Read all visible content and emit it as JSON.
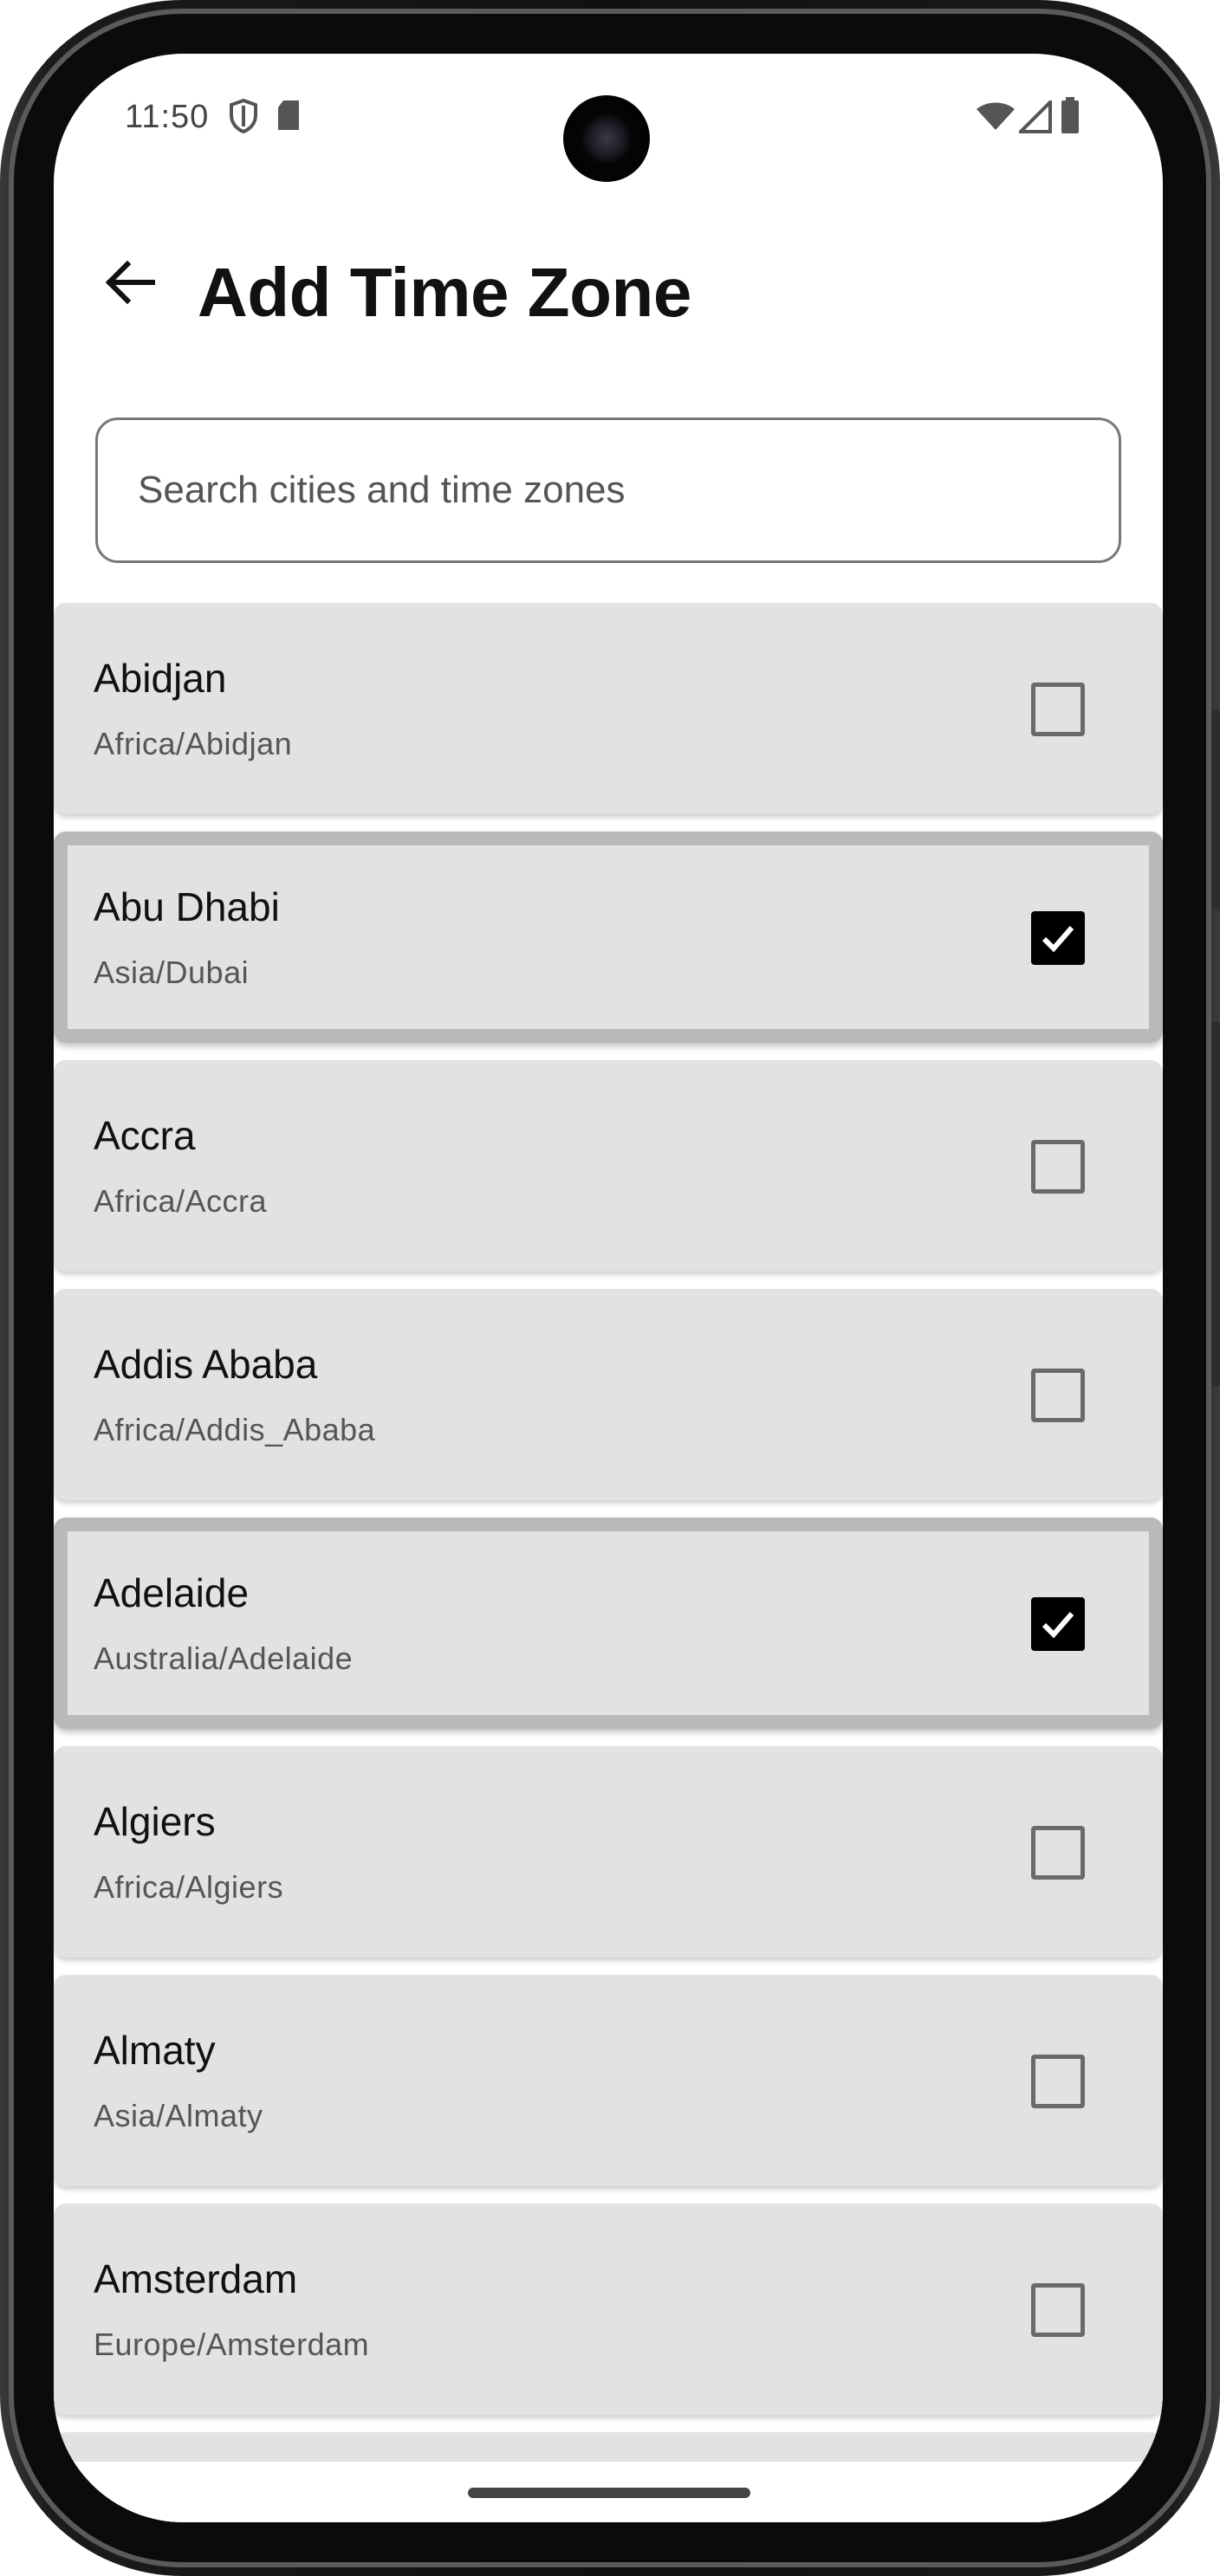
{
  "status_bar": {
    "time": "11:50",
    "left_icons": [
      "shield-icon",
      "sd-card-icon"
    ],
    "right_icons": [
      "wifi-icon",
      "cell-signal-icon",
      "battery-icon"
    ]
  },
  "app_bar": {
    "back_icon": "arrow-back-icon",
    "title": "Add Time Zone"
  },
  "search": {
    "placeholder": "Search cities and time zones",
    "value": ""
  },
  "time_zones": [
    {
      "city": "Abidjan",
      "zone": "Africa/Abidjan",
      "checked": false
    },
    {
      "city": "Abu Dhabi",
      "zone": "Asia/Dubai",
      "checked": true
    },
    {
      "city": "Accra",
      "zone": "Africa/Accra",
      "checked": false
    },
    {
      "city": "Addis Ababa",
      "zone": "Africa/Addis_Ababa",
      "checked": false
    },
    {
      "city": "Adelaide",
      "zone": "Australia/Adelaide",
      "checked": true
    },
    {
      "city": "Algiers",
      "zone": "Africa/Algiers",
      "checked": false
    },
    {
      "city": "Almaty",
      "zone": "Asia/Almaty",
      "checked": false
    },
    {
      "city": "Amsterdam",
      "zone": "Europe/Amsterdam",
      "checked": false
    }
  ],
  "colors": {
    "item_background": "#e2e2e2",
    "selected_outline": "#b9b9b9",
    "checkbox_checked": "#000000"
  }
}
